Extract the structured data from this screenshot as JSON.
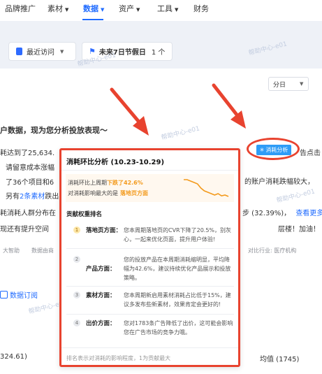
{
  "nav": {
    "items": [
      {
        "label": "品牌推广",
        "caret": false,
        "active": false
      },
      {
        "label": "素材",
        "caret": true,
        "active": false
      },
      {
        "label": "数据",
        "caret": true,
        "active": true
      },
      {
        "label": "资产",
        "caret": true,
        "active": false
      },
      {
        "label": "工具",
        "caret": true,
        "active": false
      },
      {
        "label": "财务",
        "caret": false,
        "active": false
      }
    ]
  },
  "quick": {
    "recent_label": "最近访问",
    "holiday_label": "未来7日节假日",
    "holiday_count": "1 个"
  },
  "granularity": "分日",
  "background": {
    "headline": "户数据，现为您分析投放表现～",
    "line1": "耗达到了25,634.",
    "line1_right": "告点击",
    "line2": "请留意成本涨幅",
    "line2_right": "的账户消耗跌幅较大，",
    "line3": "了36个项目和6",
    "line4_prefix": "另有",
    "line4_link": "2条素材",
    "line4_suffix": "跌出",
    "line5": "耗消耗人群分布在",
    "line5_right": "步 (32.39%)，",
    "line5_link": "查看更多",
    "line6": "现还有提升空间",
    "line6_right": "层楼！加油！",
    "meta_left": "大智助",
    "meta_mid": "数据由商",
    "meta_right": "对比行业: 医疗机构",
    "subscribe": "数据订阅",
    "bottom_left": "324.61)",
    "bottom_right": "均值 (1745)"
  },
  "watermark": "帮助中心-e01",
  "analysis_button": "消耗分析",
  "popup": {
    "title": "消耗环比分析 (10.23-10.29)",
    "summary_prefix": "消耗环比上周期",
    "summary_highlight": "下跌了42.6%",
    "top_factor_prefix": "对消耗影响最大的是",
    "top_factor_highlight": "落地页方面",
    "ranking_title": "贡献权重排名",
    "rows": [
      {
        "rank": "1",
        "label": "落地页方面：",
        "desc": "您本周期落地页的CVR下降了20.5%，别灰心，一起来优化页面，提升用户体验!"
      },
      {
        "rank": "2",
        "label": "产品方面：",
        "desc": "您的投放产品在本周期消耗缩明显，平均降幅为42.6%，建议持续优化产品展示和投放策略。"
      },
      {
        "rank": "3",
        "label": "素材方面：",
        "desc": "您本周期新启用素材消耗占比低于15%，建议多发布些新素材，效果肯定会更好的!"
      },
      {
        "rank": "4",
        "label": "出价方面：",
        "desc": "您对1783条广告降低了出价，这可能会影响您在广告市场的竞争力哦。"
      }
    ],
    "footer": "排名表示对消耗的影响程度，1为贡献最大"
  },
  "chart_data": {
    "type": "line",
    "values": [
      9,
      9,
      8.5,
      8,
      7.5,
      6,
      5,
      4.5,
      4,
      3.5,
      4,
      3.2,
      3.5,
      3
    ],
    "color": "#f39a1c"
  }
}
